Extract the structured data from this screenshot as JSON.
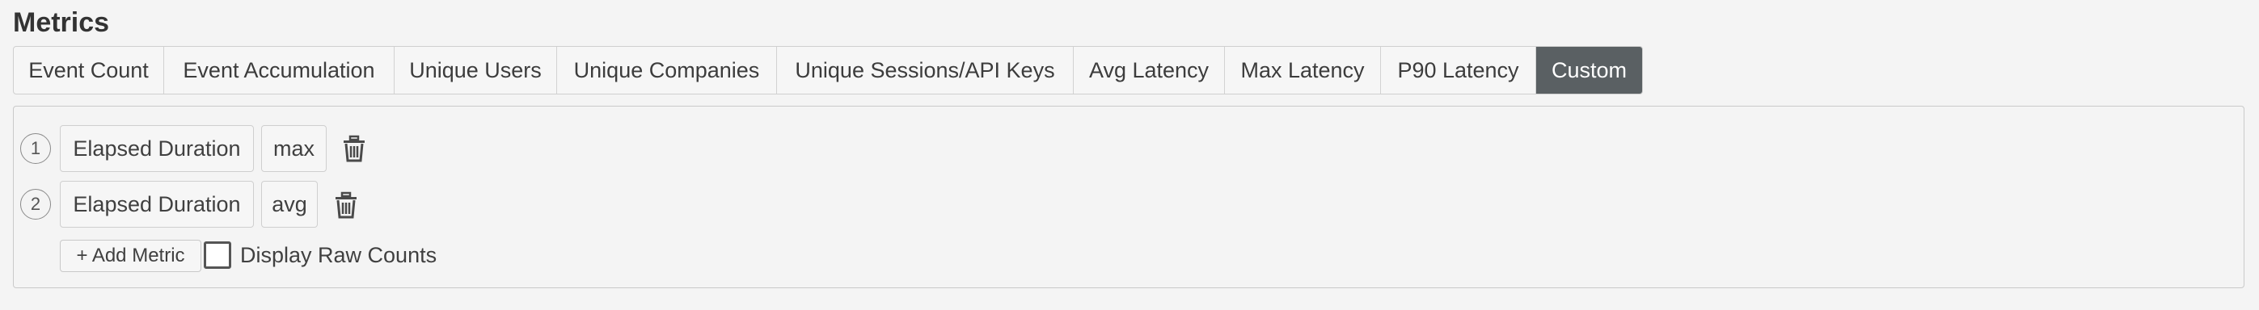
{
  "section_title": "Metrics",
  "tabs": [
    {
      "label": "Event Count",
      "active": false
    },
    {
      "label": "Event Accumulation",
      "active": false
    },
    {
      "label": "Unique Users",
      "active": false
    },
    {
      "label": "Unique Companies",
      "active": false
    },
    {
      "label": "Unique Sessions/API Keys",
      "active": false
    },
    {
      "label": "Avg Latency",
      "active": false
    },
    {
      "label": "Max Latency",
      "active": false
    },
    {
      "label": "P90 Latency",
      "active": false
    },
    {
      "label": "Custom",
      "active": true
    }
  ],
  "metrics": [
    {
      "index": "1",
      "field": "Elapsed Duration",
      "aggregation": "max",
      "delete_icon": "trash-icon"
    },
    {
      "index": "2",
      "field": "Elapsed Duration",
      "aggregation": "avg",
      "delete_icon": "trash-icon"
    }
  ],
  "add_metric_label": "+ Add Metric",
  "display_raw_counts": {
    "label": "Display Raw Counts",
    "checked": false
  },
  "colors": {
    "active_tab_bg": "#5a6063",
    "background": "#f4f4f4",
    "border": "#cfcfcf"
  }
}
